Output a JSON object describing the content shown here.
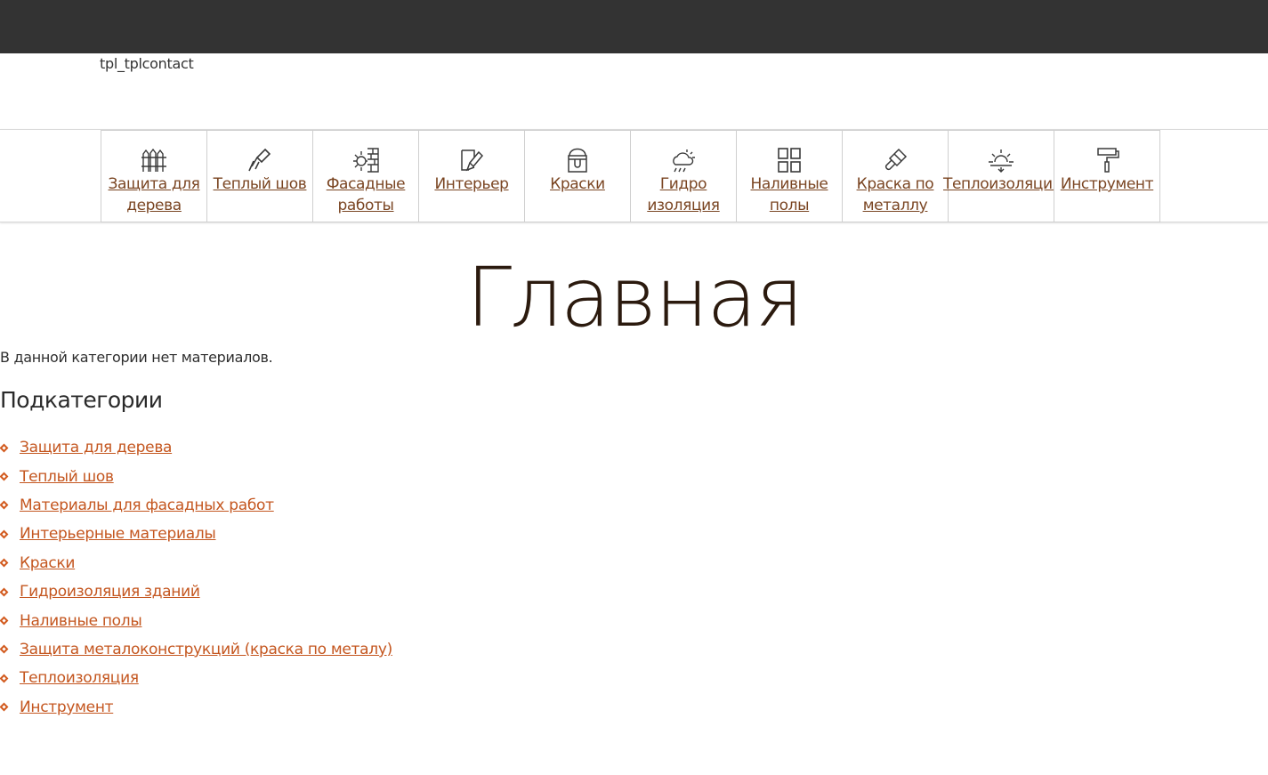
{
  "header": {
    "tpl_label": "tpl_tplcontact"
  },
  "nav": {
    "items": [
      {
        "label": "Защита для дерева",
        "icon": "fence-icon"
      },
      {
        "label": "Теплый шов",
        "icon": "caulk-gun-icon"
      },
      {
        "label": "Фасадные работы",
        "icon": "sun-brick-icon"
      },
      {
        "label": "Интерьер",
        "icon": "brush-wall-icon"
      },
      {
        "label": "Краски",
        "icon": "paint-bucket-icon"
      },
      {
        "label": "Гидро изоляция",
        "icon": "rain-cloud-icon"
      },
      {
        "label": "Наливные полы",
        "icon": "floor-grid-icon"
      },
      {
        "label": "Краска по металлу",
        "icon": "paintbrush-icon"
      },
      {
        "label": "Теплоизоляция",
        "icon": "sunrise-icon"
      },
      {
        "label": "Инструмент",
        "icon": "paint-roller-icon"
      }
    ]
  },
  "main": {
    "title": "Главная",
    "empty_message": "В данной категории нет материалов.",
    "subcategories_heading": "Подкатегории",
    "subcategories": [
      "Защита для дерева",
      "Теплый шов",
      "Материалы для фасадных работ",
      "Интерьерные материалы",
      "Краски",
      "Гидроизоляция зданий",
      "Наливные полы",
      "Защита металоконструкций (краска по металу)",
      "Теплоизоляция",
      "Инструмент"
    ]
  },
  "colors": {
    "topbar": "#333333",
    "link": "#c4561f",
    "nav_link": "#7a4522",
    "title": "#2b1a0e"
  }
}
